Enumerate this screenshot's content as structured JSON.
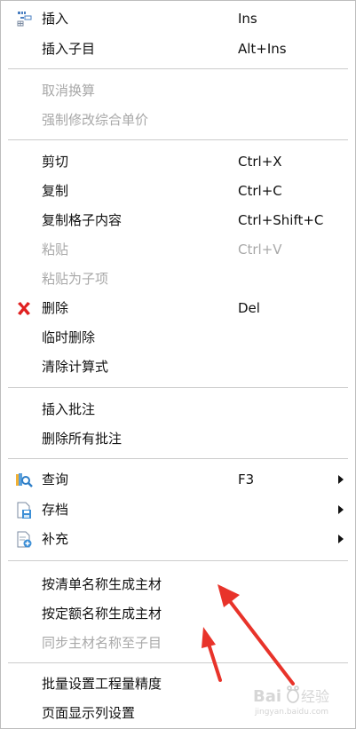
{
  "menu": {
    "insert": {
      "label": "插入",
      "shortcut": "Ins"
    },
    "insert_child": {
      "label": "插入子目",
      "shortcut": "Alt+Ins"
    },
    "cancel_conversion": {
      "label": "取消换算"
    },
    "force_modify_price": {
      "label": "强制修改综合单价"
    },
    "cut": {
      "label": "剪切",
      "shortcut": "Ctrl+X"
    },
    "copy": {
      "label": "复制",
      "shortcut": "Ctrl+C"
    },
    "copy_cell": {
      "label": "复制格子内容",
      "shortcut": "Ctrl+Shift+C"
    },
    "paste": {
      "label": "粘贴",
      "shortcut": "Ctrl+V"
    },
    "paste_as_child": {
      "label": "粘贴为子项"
    },
    "delete": {
      "label": "删除",
      "shortcut": "Del"
    },
    "temp_delete": {
      "label": "临时删除"
    },
    "clear_formula": {
      "label": "清除计算式"
    },
    "insert_comment": {
      "label": "插入批注"
    },
    "delete_all_comments": {
      "label": "删除所有批注"
    },
    "query": {
      "label": "查询",
      "shortcut": "F3"
    },
    "archive": {
      "label": "存档"
    },
    "supplement": {
      "label": "补充"
    },
    "gen_by_list_name": {
      "label": "按清单名称生成主材"
    },
    "gen_by_quota_name": {
      "label": "按定额名称生成主材"
    },
    "sync_main_material": {
      "label": "同步主材名称至子目"
    },
    "batch_precision": {
      "label": "批量设置工程量精度"
    },
    "page_columns": {
      "label": "页面显示列设置"
    }
  },
  "icons": {
    "insert": "insert-tree-icon",
    "delete": "red-x-icon",
    "query": "query-magnifier-icon",
    "archive": "archive-disk-icon",
    "supplement": "supplement-doc-icon"
  },
  "colors": {
    "text": "#111111",
    "disabled_text": "#a8a8a8",
    "separator": "#cccccc",
    "annotation_arrow": "#e8332a",
    "delete_icon": "#e02020"
  },
  "watermark": {
    "text": "Bai 经验",
    "subtext": "jingyan.baidu.com"
  }
}
